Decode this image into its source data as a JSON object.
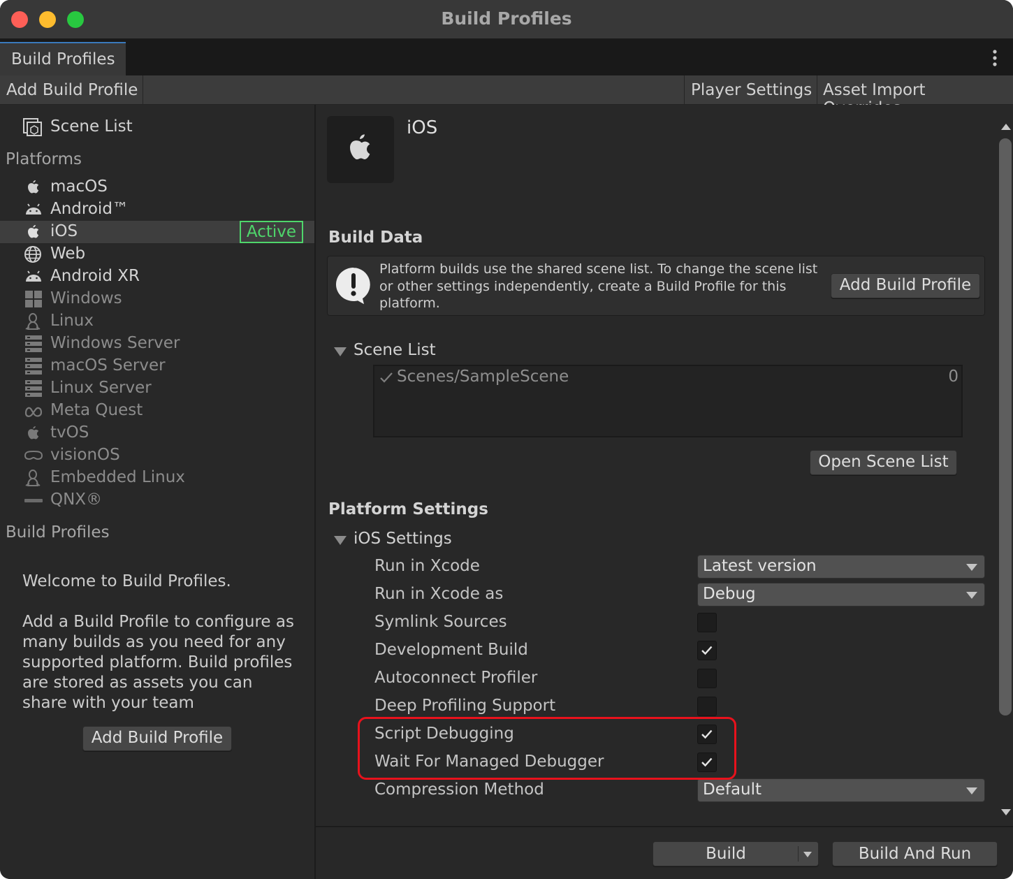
{
  "window": {
    "title": "Build Profiles"
  },
  "tabs": [
    {
      "label": "Build Profiles"
    }
  ],
  "toolbar": {
    "add_build_profile": "Add Build Profile",
    "player_settings": "Player Settings",
    "asset_import_overrides": "Asset Import Overrides"
  },
  "sidebar": {
    "scene_list_label": "Scene List",
    "platforms_header": "Platforms",
    "platforms": [
      {
        "label": "macOS",
        "icon": "apple-icon",
        "state": "available"
      },
      {
        "label": "Android™",
        "icon": "android-icon",
        "state": "available"
      },
      {
        "label": "iOS",
        "icon": "apple-icon",
        "state": "selected"
      },
      {
        "label": "Web",
        "icon": "globe-icon",
        "state": "available"
      },
      {
        "label": "Android XR",
        "icon": "android-icon",
        "state": "available"
      },
      {
        "label": "Windows",
        "icon": "windows-icon",
        "state": "not-installed"
      },
      {
        "label": "Linux",
        "icon": "linux-penguin-icon",
        "state": "not-installed"
      },
      {
        "label": "Windows Server",
        "icon": "server-icon",
        "state": "not-installed"
      },
      {
        "label": "macOS Server",
        "icon": "server-icon",
        "state": "not-installed"
      },
      {
        "label": "Linux Server",
        "icon": "server-icon",
        "state": "not-installed"
      },
      {
        "label": "Meta Quest",
        "icon": "meta-infinity-icon",
        "state": "not-installed"
      },
      {
        "label": "tvOS",
        "icon": "apple-icon",
        "state": "not-installed"
      },
      {
        "label": "visionOS",
        "icon": "vision-pro-icon",
        "state": "not-installed"
      },
      {
        "label": "Embedded Linux",
        "icon": "linux-penguin-icon",
        "state": "not-installed"
      },
      {
        "label": "QNX®",
        "icon": "qnx-logo-icon",
        "state": "not-installed"
      }
    ],
    "active_badge": "Active",
    "build_profiles_header": "Build Profiles",
    "welcome_title": "Welcome to Build Profiles.",
    "welcome_body": "Add a Build Profile to configure as many builds as you need for any supported platform. Build profiles are stored as assets you can share with your team",
    "add_build_profile_button": "Add Build Profile"
  },
  "detail": {
    "platform_name": "iOS",
    "platform_icon": "apple-icon",
    "build_data_header": "Build Data",
    "help_text": "Platform builds use the shared scene list. To change the scene list or other settings independently, create a Build Profile for this platform.",
    "help_button": "Add Build Profile",
    "scene_list_foldout": "Scene List",
    "scenes": [
      {
        "name": "Scenes/SampleScene",
        "index": "0",
        "enabled": true
      }
    ],
    "open_scene_list_button": "Open Scene List",
    "platform_settings_header": "Platform Settings",
    "ios_settings_foldout": "iOS Settings",
    "settings": [
      {
        "label": "Run in Xcode",
        "type": "dropdown",
        "value": "Latest version"
      },
      {
        "label": "Run in Xcode as",
        "type": "dropdown",
        "value": "Debug"
      },
      {
        "label": "Symlink Sources",
        "type": "checkbox",
        "checked": false
      },
      {
        "label": "Development Build",
        "type": "checkbox",
        "checked": true
      },
      {
        "label": "Autoconnect Profiler",
        "type": "checkbox",
        "checked": false
      },
      {
        "label": "Deep Profiling Support",
        "type": "checkbox",
        "checked": false
      },
      {
        "label": "Script Debugging",
        "type": "checkbox",
        "checked": true
      },
      {
        "label": "Wait For Managed Debugger",
        "type": "checkbox",
        "checked": true
      },
      {
        "label": "Compression Method",
        "type": "dropdown",
        "value": "Default"
      }
    ],
    "highlight_color": "#e8121c"
  },
  "footer": {
    "build_button": "Build",
    "build_and_run_button": "Build And Run"
  },
  "colors": {
    "active_green": "#4fd66b",
    "tab_accent": "#3a79bb"
  }
}
